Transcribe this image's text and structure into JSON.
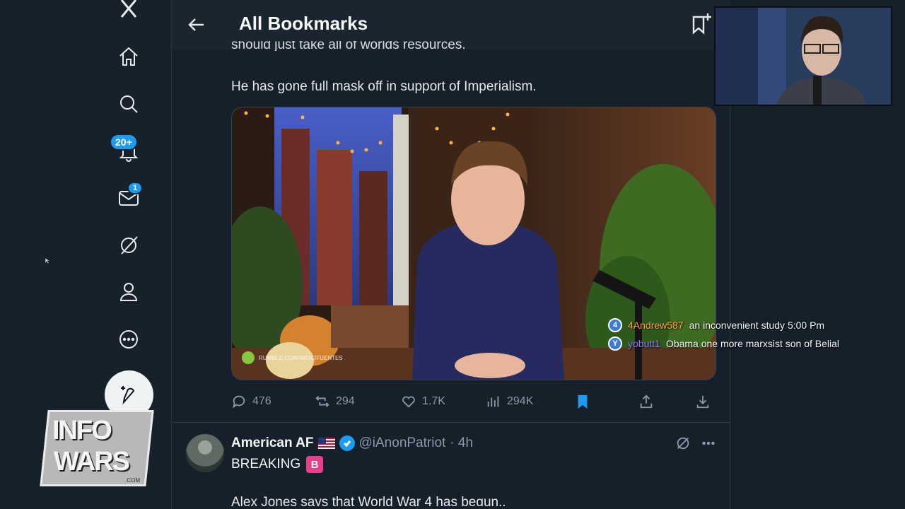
{
  "sidebar": {
    "notifications_badge": "20+",
    "messages_badge": "1"
  },
  "overlay": {
    "logo_line1": "INFO",
    "logo_line2": "WARS",
    "logo_suffix": ".COM"
  },
  "header": {
    "title": "All Bookmarks"
  },
  "tweet": {
    "text_cut": "should just take all of worlds resources.",
    "text": "He has gone full mask off in support of Imperialism.",
    "media_watermark": "RUMBLE.COM/NICKJFUENTES",
    "replies": "476",
    "retweets": "294",
    "likes": "1.7K",
    "views": "294K"
  },
  "next_tweet": {
    "author": "American AF",
    "handle": "@iAnonPatriot",
    "time": "· 4h",
    "line1": "BREAKING",
    "badge": "B",
    "line2": "Alex Jones says that World War 4 has begun.."
  },
  "chat": [
    {
      "badge": "4",
      "user": "4Andrew587",
      "message": "an inconvenient study 5:00 Pm"
    },
    {
      "badge": "Y",
      "user": "yobutt1",
      "message": "Obama one more marxsist son of Belial"
    }
  ],
  "colors": {
    "background": "#15202b",
    "accent": "#1d9bf0",
    "bookmark_active": "#1d9bf0"
  }
}
